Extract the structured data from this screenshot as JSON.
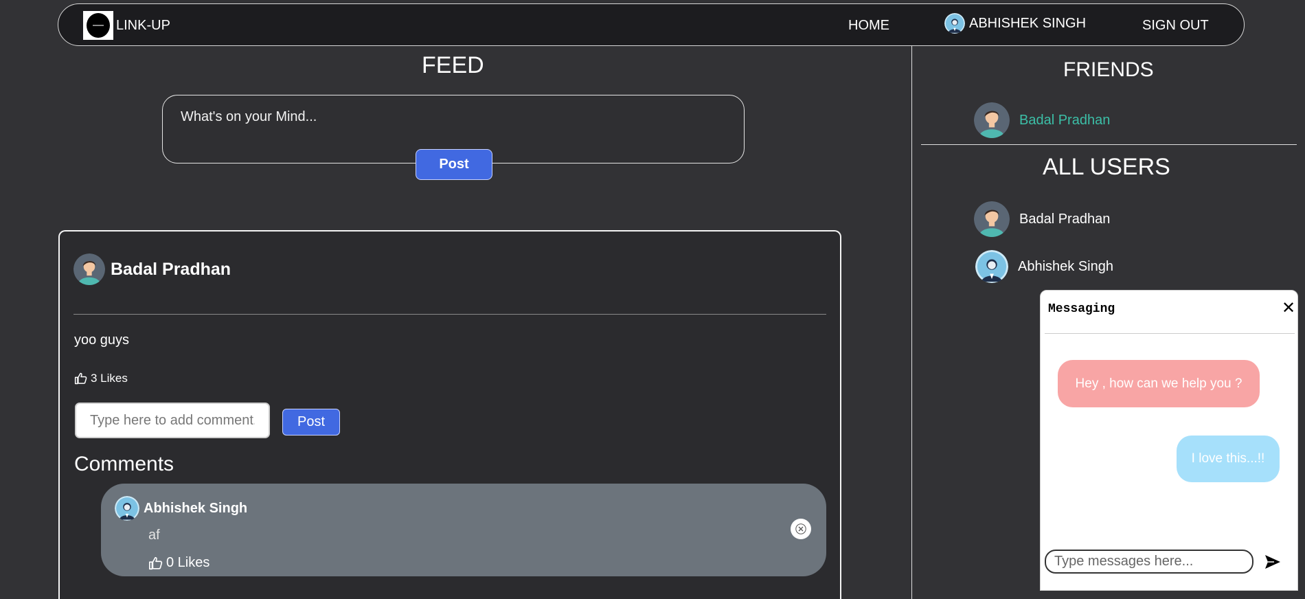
{
  "header": {
    "brand": "LINK-UP",
    "nav": {
      "home": "HOME",
      "user": "ABHISHEK SINGH",
      "signout": "SIGN OUT"
    },
    "icons": {
      "logo": "linkup-logo",
      "user_avatar": "user-avatar-icon"
    }
  },
  "feed": {
    "title": "FEED",
    "composer_placeholder": "What's on your Mind...",
    "post_button": "Post"
  },
  "post": {
    "author": "Badal Pradhan",
    "text": "yoo guys",
    "likes": "3 Likes",
    "comment_placeholder": "Type here to add comment.",
    "comment_button": "Post",
    "comments_heading": "Comments",
    "comments": [
      {
        "author": "Abhishek Singh",
        "text": "af",
        "likes": "0 Likes"
      }
    ]
  },
  "sidebar": {
    "friends_title": "FRIENDS",
    "friends": [
      "Badal Pradhan"
    ],
    "all_users_title": "ALL USERS",
    "users": [
      "Badal Pradhan",
      "Abhishek Singh"
    ]
  },
  "chat": {
    "title": "Messaging",
    "close": "✕",
    "messages": [
      {
        "from": "support",
        "text": "Hey , how can we help you ?"
      },
      {
        "from": "me",
        "text": "I love this...!!"
      }
    ],
    "input_placeholder": "Type messages here..."
  },
  "colors": {
    "background": "#323235",
    "accent_blue": "#4169e1",
    "friend_link": "#3cbfa7",
    "bubble_in": "#f8a5a5",
    "bubble_out": "#a6e0fb",
    "comment_card": "#6c747c"
  }
}
